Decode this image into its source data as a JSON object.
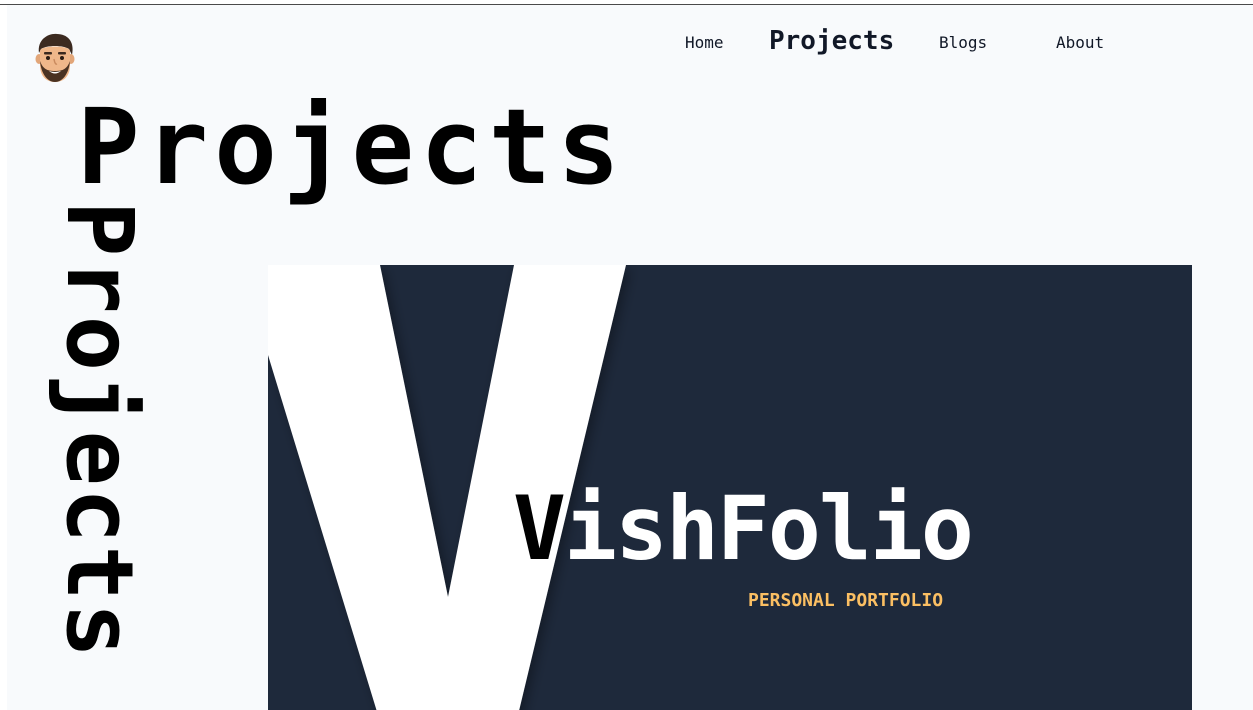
{
  "nav": {
    "items": [
      {
        "label": "Home"
      },
      {
        "label": "Projects",
        "active": true
      },
      {
        "label": "Blogs"
      },
      {
        "label": "About"
      }
    ]
  },
  "avatar": {
    "icon": "memoji-avatar-icon"
  },
  "hero": {
    "title": "Projects",
    "vertical_title": "Projects"
  },
  "project": {
    "brand_first": "V",
    "brand_rest": "ishFolio",
    "tagline": "PERSONAL PORTFOLIO",
    "card_color": "#1e293b",
    "tagline_color": "#fbbf63"
  }
}
